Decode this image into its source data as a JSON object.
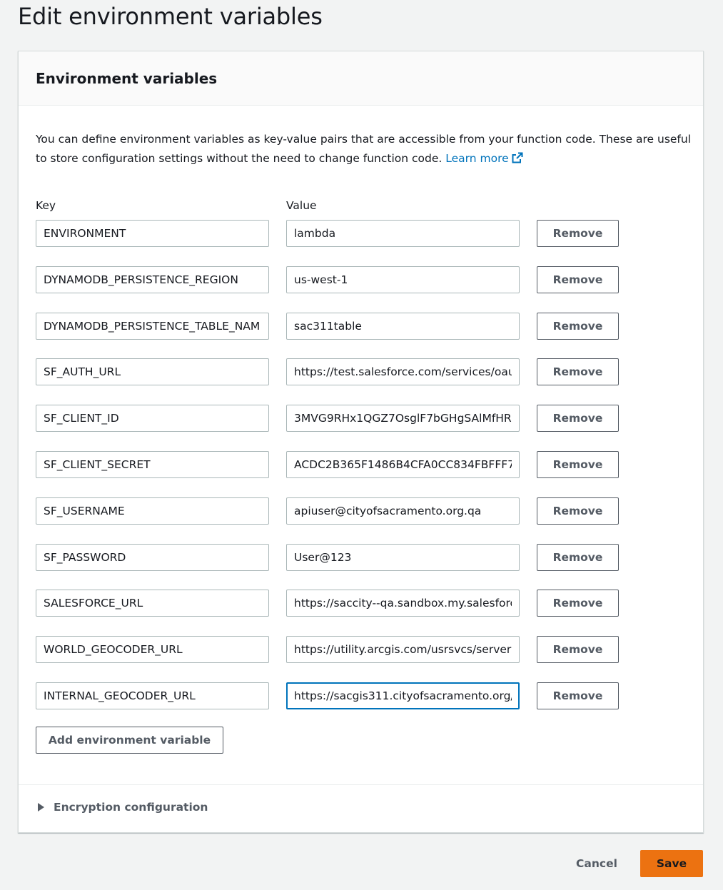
{
  "page": {
    "title": "Edit environment variables"
  },
  "panel": {
    "header": "Environment variables",
    "description": "You can define environment variables as key-value pairs that are accessible from your function code. These are useful to store configuration settings without the need to change function code.",
    "learn_more": "Learn more",
    "key_label": "Key",
    "value_label": "Value",
    "remove_label": "Remove",
    "add_label": "Add environment variable",
    "encryption_label": "Encryption configuration"
  },
  "variables": [
    {
      "key": "ENVIRONMENT",
      "value": "lambda"
    },
    {
      "key": "DYNAMODB_PERSISTENCE_REGION",
      "value": "us-west-1"
    },
    {
      "key": "DYNAMODB_PERSISTENCE_TABLE_NAM",
      "value": "sac311table"
    },
    {
      "key": "SF_AUTH_URL",
      "value": "https://test.salesforce.com/services/oau"
    },
    {
      "key": "SF_CLIENT_ID",
      "value": "3MVG9RHx1QGZ7OsglF7bGHgSAlMfHR"
    },
    {
      "key": "SF_CLIENT_SECRET",
      "value": "ACDC2B365F1486B4CFA0CC834FBFFF7("
    },
    {
      "key": "SF_USERNAME",
      "value": "apiuser@cityofsacramento.org.qa"
    },
    {
      "key": "SF_PASSWORD",
      "value": "User@123"
    },
    {
      "key": "SALESFORCE_URL",
      "value": "https://saccity--qa.sandbox.my.salesforc"
    },
    {
      "key": "WORLD_GEOCODER_URL",
      "value": "https://utility.arcgis.com/usrsvcs/server:"
    },
    {
      "key": "INTERNAL_GEOCODER_URL",
      "value": "https://sacgis311.cityofsacramento.org/"
    }
  ],
  "footer": {
    "cancel_label": "Cancel",
    "save_label": "Save"
  },
  "colors": {
    "accent": "#ec7211",
    "link": "#0073bb",
    "focus": "#0073bb"
  }
}
